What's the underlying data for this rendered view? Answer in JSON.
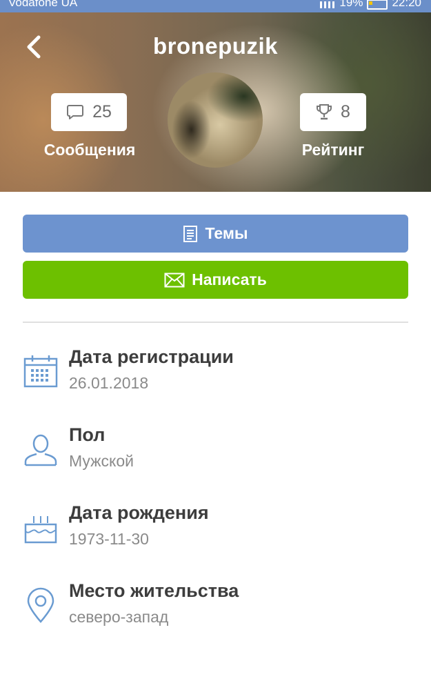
{
  "status_bar": {
    "carrier": "Vodafone UA",
    "battery": "19%",
    "time": "22:20"
  },
  "header": {
    "username": "bronepuzik",
    "messages": {
      "count": "25",
      "label": "Сообщения",
      "icon": "speech-bubble-icon"
    },
    "rating": {
      "count": "8",
      "label": "Рейтинг",
      "icon": "trophy-icon"
    }
  },
  "actions": {
    "topics_label": "Темы",
    "write_label": "Написать"
  },
  "info": [
    {
      "title": "Дата регистрации",
      "value": "26.01.2018",
      "icon": "calendar-icon"
    },
    {
      "title": "Пол",
      "value": "Мужской",
      "icon": "user-icon"
    },
    {
      "title": "Дата рождения",
      "value": "1973-11-30",
      "icon": "birthday-cake-icon"
    },
    {
      "title": "Место жительства",
      "value": "северо-запад",
      "icon": "location-pin-icon"
    }
  ],
  "colors": {
    "status_bar": "#6b8fc9",
    "topics_button": "#6d93cf",
    "write_button": "#6dc000",
    "icon_blue": "#6a9bd1"
  }
}
